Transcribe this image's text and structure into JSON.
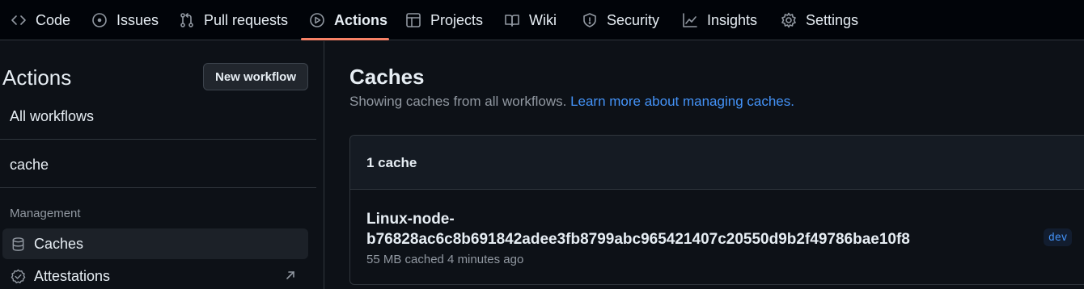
{
  "repo_nav": {
    "tabs": [
      {
        "label": "Code",
        "icon": "code-icon"
      },
      {
        "label": "Issues",
        "icon": "issue-opened-icon"
      },
      {
        "label": "Pull requests",
        "icon": "git-pull-request-icon"
      },
      {
        "label": "Actions",
        "icon": "play-icon",
        "selected": true
      },
      {
        "label": "Projects",
        "icon": "table-icon"
      },
      {
        "label": "Wiki",
        "icon": "book-icon"
      },
      {
        "label": "Security",
        "icon": "shield-icon"
      },
      {
        "label": "Insights",
        "icon": "graph-icon"
      },
      {
        "label": "Settings",
        "icon": "gear-icon"
      }
    ],
    "selected_underline_color": "#f78166"
  },
  "sidebar": {
    "title": "Actions",
    "new_workflow_label": "New workflow",
    "workflows": [
      "All workflows",
      "cache"
    ],
    "management_heading": "Management",
    "management_items": [
      {
        "label": "Caches",
        "icon": "database-icon",
        "active": true
      },
      {
        "label": "Attestations",
        "icon": "verified-icon",
        "external": true
      }
    ]
  },
  "main": {
    "title": "Caches",
    "description": "Showing caches from all workflows.",
    "learn_more_link": "Learn more about managing caches.",
    "count_label": "1 cache",
    "caches": [
      {
        "name_line1": "Linux-node-",
        "name_line2": "b76828ac6c8b691842adee3fb8799abc965421407c20550d9b2f49786bae10f8",
        "size": "55 MB",
        "meta": "55 MB cached 4 minutes ago",
        "branch": "dev"
      }
    ]
  },
  "colors": {
    "background": "#0d1117",
    "nav_background": "#010409",
    "link": "#4493f8",
    "muted_text": "#9198a1",
    "border": "#30363d"
  }
}
